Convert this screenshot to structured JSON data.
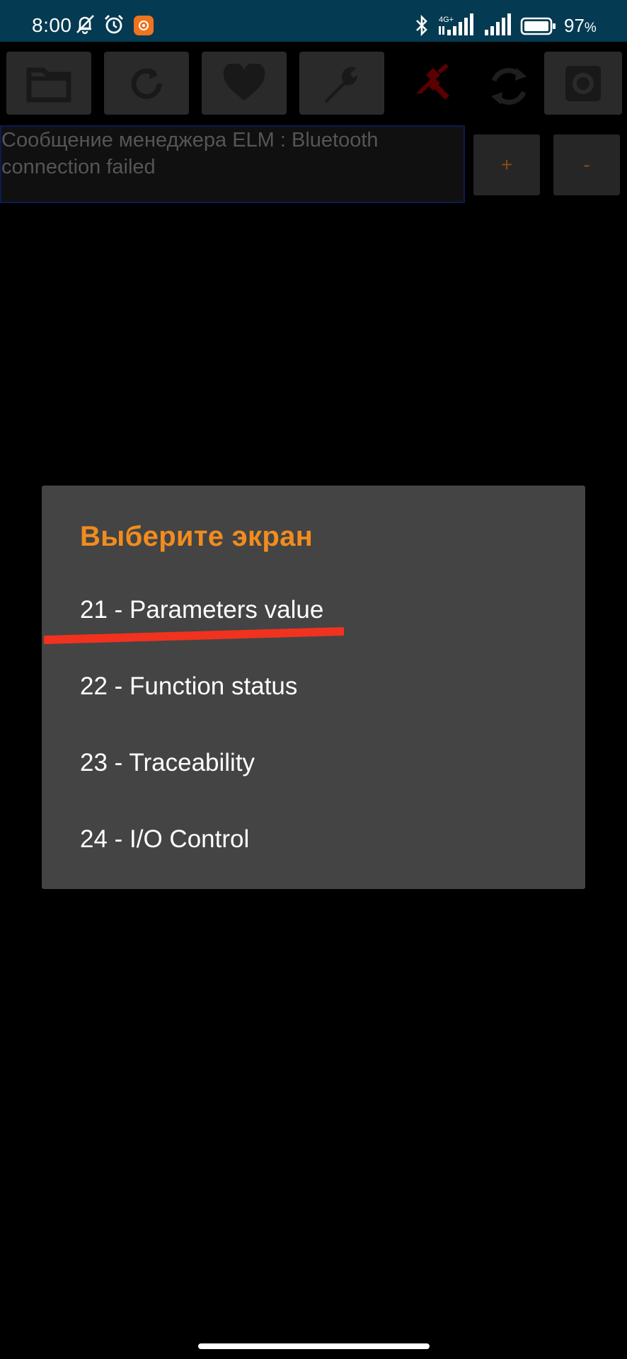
{
  "status_bar": {
    "time": "8:00",
    "icons": [
      "mute-bell-icon",
      "alarm-icon",
      "app-notification-icon",
      "bluetooth-icon",
      "signal-4g-icon",
      "signal-icon",
      "battery-icon"
    ],
    "network_label": "4G+",
    "battery_percent": "97",
    "battery_unit": "%"
  },
  "toolbar": {
    "buttons": [
      "folder-icon",
      "refresh-icon",
      "heart-icon",
      "wrench-icon",
      "bluetooth-disconnected-icon",
      "sync-icon",
      "settings-icon"
    ]
  },
  "message": {
    "text": "Сообщение менеджера ELM : Bluetooth connection failed"
  },
  "zoom": {
    "plus_label": "+",
    "minus_label": "-"
  },
  "dialog": {
    "title": "Выберите экран",
    "items": [
      "21 - Parameters value",
      "22 - Function status",
      "23 - Traceability",
      "24 - I/O Control"
    ]
  },
  "colors": {
    "status_bar": "#043a52",
    "dialog_bg": "#444444",
    "title_accent": "#f28c1e",
    "annotation": "#f0321e"
  }
}
